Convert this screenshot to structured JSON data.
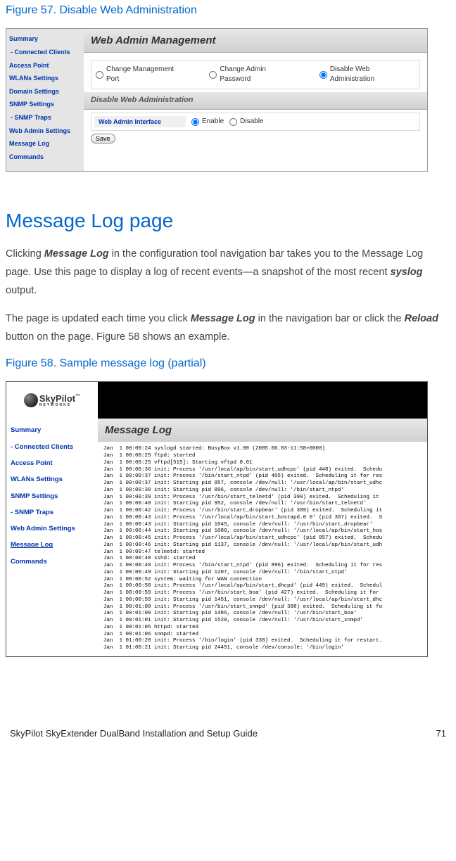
{
  "fig57_title": "Figure 57. Disable Web Administration",
  "sidebar1": {
    "i0": "Summary",
    "i1": "- Connected Clients",
    "i2": "Access Point",
    "i3": "WLANs Settings",
    "i4": "Domain Settings",
    "i5": "SNMP Settings",
    "i6": "- SNMP Traps",
    "i7": "Web Admin Settings",
    "i8": "Message Log",
    "i9": "Commands"
  },
  "panel1": {
    "header": "Web Admin Management",
    "r1": "Change Management Port",
    "r2": "Change Admin Password",
    "r3": "Disable Web Administration",
    "subsection": "Disable Web Administration",
    "setting_label": "Web Admin Interface",
    "enable": "Enable",
    "disable": "Disable",
    "save": "Save"
  },
  "heading": "Message Log page",
  "para1_a": "Clicking ",
  "para1_msg": "Message Log",
  "para1_b": " in the configuration tool navigation bar takes you to the Message Log page. Use this page to display a log of recent events—a snapshot of the most recent ",
  "para1_syslog": "syslog",
  "para1_c": " output.",
  "para2_a": "The page is updated each time you click ",
  "para2_msg": "Message Log",
  "para2_b": " in the navigation bar or click the ",
  "para2_reload": "Reload",
  "para2_c": " button on the page. Figure 58 shows an example.",
  "fig58_title": "Figure 58. Sample message log (partial)",
  "logo_text": "SkyPilot",
  "logo_sub": "NETWORKS",
  "logo_tm": "™",
  "sidebar2": {
    "i0": "Summary",
    "i1": "- Connected Clients",
    "i2": "Access Point",
    "i3": "WLANs Settings",
    "i4": "SNMP Settings",
    "i5": "- SNMP Traps",
    "i6": "Web Admin Settings",
    "i7": "Message Log",
    "i8": "Commands"
  },
  "log_header": "Message Log",
  "log_content": "Jan  1 00:00:24 syslogd started: BusyBox v1.00 (2005.06.03-11:58+0000)\nJan  1 00:00:25 ftpd: started\nJan  1 00:00:25 vftpd[515]: Starting vftpd 0.01\nJan  1 00:00:36 init: Process '/usr/local/ap/bin/start_udhcpc' (pid 448) exited.  Schedu\nJan  1 00:00:37 init: Process '/bin/start_ntpd' (pid 405) exited.  Scheduling it for res\nJan  1 00:00:37 init: Starting pid 857, console /dev/null: '/usr/local/ap/bin/start_udhc\nJan  1 00:00:38 init: Starting pid 896, console /dev/null: '/bin/start_ntpd'\nJan  1 00:00:39 init: Process '/usr/bin/start_telnetd' (pid 390) exited.  Scheduling it\nJan  1 00:00:40 init: Starting pid 952, console /dev/null: '/usr/bin/start_telnetd'\nJan  1 00:00:42 init: Process '/usr/bin/start_dropbear' (pid 389) exited.  Scheduling it\nJan  1 00:00:43 init: Process '/usr/local/ap/bin/start_hostapd.0 0' (pid 367) exited.  S\nJan  1 00:00:43 init: Starting pid 1045, console /dev/null: '/usr/bin/start_dropbear'\nJan  1 00:00:44 init: Starting pid 1080, console /dev/null: '/usr/local/ap/bin/start_hos\nJan  1 00:00:45 init: Process '/usr/local/ap/bin/start_udhcpc' (pid 857) exited.  Schedu\nJan  1 00:00:46 init: Starting pid 1137, console /dev/null: '/usr/local/ap/bin/start_udh\nJan  1 00:00:47 telnetd: started\nJan  1 00:00:48 sshd: started\nJan  1 00:00:48 init: Process '/bin/start_ntpd' (pid 896) exited.  Scheduling it for res\nJan  1 00:00:49 init: Starting pid 1207, console /dev/null: '/bin/start_ntpd'\nJan  1 00:00:52 system: waiting for WAN connection\nJan  1 00:00:58 init: Process '/usr/local/ap/bin/start_dhcpd' (pid 449) exited.  Schedul\nJan  1 00:00:59 init: Process '/usr/bin/start_boa' (pid 427) exited.  Scheduling it for\nJan  1 00:00:59 init: Starting pid 1451, console /dev/null: '/usr/local/ap/bin/start_dhc\nJan  1 00:01:00 init: Process '/usr/bin/start_snmpd' (pid 388) exited.  Scheduling it fo\nJan  1 00:01:00 init: Starting pid 1486, console /dev/null: '/usr/bin/start_boa'\nJan  1 00:01:01 init: Starting pid 1520, console /dev/null: '/usr/bin/start_snmpd'\nJan  1 00:01:05 httpd: started\nJan  1 00:01:06 snmpd: started\nJan  1 01:00:20 init: Process '/bin/login' (pid 338) exited.  Scheduling it for restart.\nJan  1 01:00:21 init: Starting pid 24451, console /dev/console: '/bin/login'",
  "footer_left": "SkyPilot SkyExtender DualBand Installation and Setup Guide",
  "footer_right": "71"
}
